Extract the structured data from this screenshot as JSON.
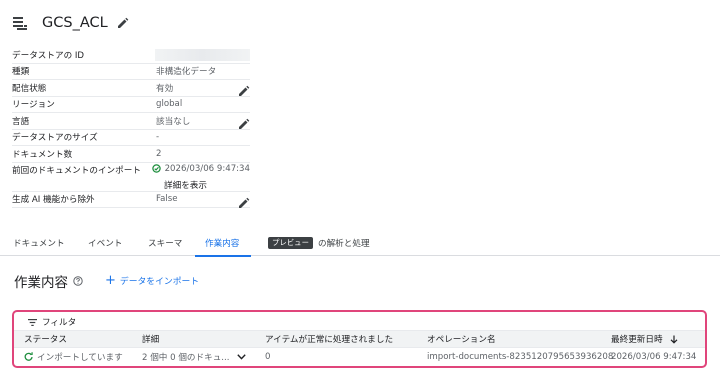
{
  "header": {
    "title": "GCS_ACL",
    "datastore_icon": "datastore-icon",
    "edit_icon": "pencil-icon"
  },
  "properties": [
    {
      "key": "データストアの ID",
      "value": ""
    },
    {
      "key": "種類",
      "value": "非構造化データ"
    },
    {
      "key": "配信状態",
      "value": "有効"
    },
    {
      "key": "リージョン",
      "value": "global"
    },
    {
      "key": "言語",
      "value": "該当なし"
    },
    {
      "key": "データストアのサイズ",
      "value": "-"
    },
    {
      "key": "ドキュメント数",
      "value": "2"
    },
    {
      "key": "前回のドキュメントのインポート",
      "value": "2026/03/06 9:47:34",
      "link": "詳細を表示"
    },
    {
      "key": "生成 AI 機能から除外",
      "value": "False"
    }
  ],
  "tabs": [
    {
      "label": "ドキュメント"
    },
    {
      "label": "イベント"
    },
    {
      "label": "スキーマ"
    },
    {
      "label": "作業内容",
      "active": true
    },
    {
      "badge": "プレビュー",
      "label": "の解析と処理"
    }
  ],
  "section": {
    "title": "作業内容",
    "import_label": "データをインポート"
  },
  "filter": {
    "label": "フィルタ"
  },
  "table": {
    "columns": [
      "ステータス",
      "詳細",
      "アイテムが正常に処理されました",
      "オペレーション名",
      "最終更新日時"
    ],
    "rows": [
      {
        "status": "インポートしています",
        "detail": "2 個中 0 個のドキュ...",
        "processed": "0",
        "operation": "import-documents-8235120795653936208",
        "updated": "2026/03/06 9:47:34"
      }
    ]
  },
  "colors": {
    "accent": "#1a73e8",
    "highlight": "#e0457b",
    "success": "#1e8e3e"
  }
}
